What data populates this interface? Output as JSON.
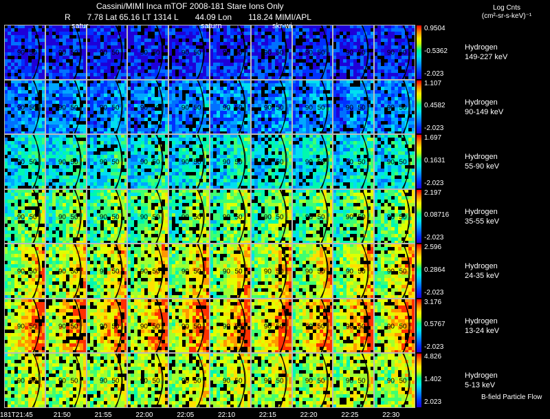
{
  "header": {
    "line1": "Cassini/MIMI Inca mTOF  2008-181   Stare   Ions Only",
    "line2_fields": [
      "R",
      "7.78 Lat 65.16 LT 1314 L",
      "44.09 Lon",
      "118.24  MIMI/APL"
    ],
    "overlays": [
      "satur",
      "saturn",
      "skr-wi"
    ]
  },
  "colorbar_title": {
    "line1": "Log Cnts",
    "line2": "(cm²-sr-s-keV)⁻¹"
  },
  "footer_note": "B-field Particle Flow",
  "time_axis": [
    "181T21:45",
    "21:50",
    "21:55",
    "22:00",
    "22:05",
    "22:10",
    "22:15",
    "22:20",
    "22:25",
    "22:30"
  ],
  "pitch_labels": [
    "90",
    "50"
  ],
  "panels": [
    {
      "species": "Hydrogen",
      "energy": "149-227 keV",
      "cb_max": "0.9504",
      "cb_mid": "-0.5362",
      "cb_min": "-2.023",
      "intensity": 0.08,
      "edge_boost": 0.02
    },
    {
      "species": "Hydrogen",
      "energy": "90-149 keV",
      "cb_max": "1.107",
      "cb_mid": "0.4582",
      "cb_min": "-2.023",
      "intensity": 0.18,
      "edge_boost": 0.06
    },
    {
      "species": "Hydrogen",
      "energy": "55-90 keV",
      "cb_max": "1.697",
      "cb_mid": "0.1631",
      "cb_min": "-2.023",
      "intensity": 0.3,
      "edge_boost": 0.1
    },
    {
      "species": "Hydrogen",
      "energy": "35-55 keV",
      "cb_max": "2.197",
      "cb_mid": "0.08716",
      "cb_min": "-2.023",
      "intensity": 0.42,
      "edge_boost": 0.14
    },
    {
      "species": "Hydrogen",
      "energy": "24-35 keV",
      "cb_max": "2.596",
      "cb_mid": "0.2864",
      "cb_min": "-2.023",
      "intensity": 0.5,
      "edge_boost": 0.18
    },
    {
      "species": "Hydrogen",
      "energy": "13-24 keV",
      "cb_max": "3.176",
      "cb_mid": "0.5767",
      "cb_min": "-2.023",
      "intensity": 0.58,
      "edge_boost": 0.2
    },
    {
      "species": "Hydrogen",
      "energy": "5-13 keV",
      "cb_max": "4.826",
      "cb_mid": "1.402",
      "cb_min": "2.023",
      "intensity": 0.55,
      "edge_boost": 0.1
    }
  ],
  "palette": [
    "#1e00d8",
    "#0030ff",
    "#0070ff",
    "#00a8ff",
    "#00e0f0",
    "#00f8b0",
    "#40ff70",
    "#a0ff30",
    "#e0ff00",
    "#ffe000",
    "#ff9800",
    "#ff3000"
  ]
}
